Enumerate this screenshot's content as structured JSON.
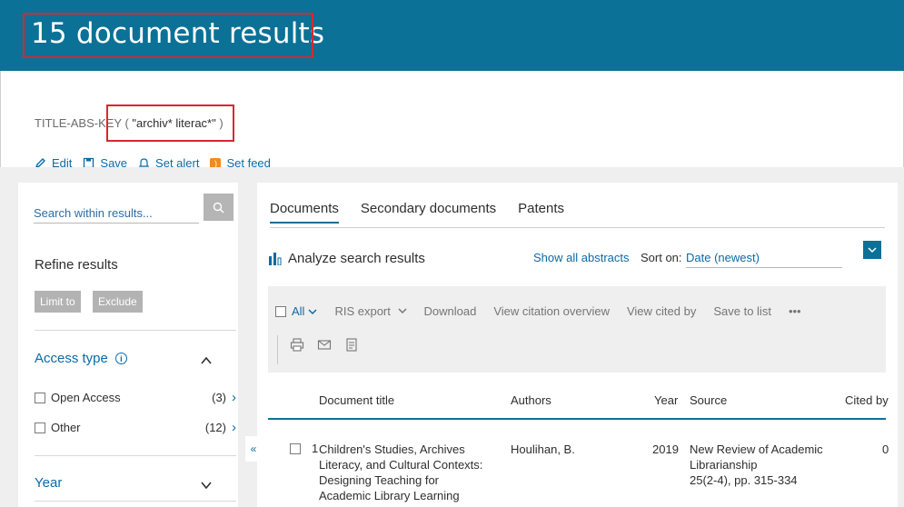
{
  "header": {
    "title": "15 document results"
  },
  "query": {
    "prefix": "TITLE-ABS-KEY",
    "open": " ( ",
    "term": "\"archiv* literac*\"",
    "close": " )"
  },
  "actions": [
    {
      "icon": "pencil-icon",
      "label": "Edit"
    },
    {
      "icon": "save-icon",
      "label": "Save"
    },
    {
      "icon": "bell-icon",
      "label": "Set alert"
    },
    {
      "icon": "rss-icon",
      "label": "Set feed"
    }
  ],
  "sidebar": {
    "search_placeholder": "Search within results...",
    "refine_label": "Refine results",
    "limit_label": "Limit to",
    "exclude_label": "Exclude",
    "facets": {
      "access": {
        "title": "Access type",
        "items": [
          {
            "label": "Open Access",
            "count": "(3)"
          },
          {
            "label": "Other",
            "count": "(12)"
          }
        ]
      },
      "year": {
        "title": "Year"
      }
    }
  },
  "tabs": [
    "Documents",
    "Secondary documents",
    "Patents"
  ],
  "analyze_label": "Analyze search results",
  "show_abstracts": "Show all abstracts",
  "sort": {
    "label": "Sort on:",
    "value": "Date (newest)"
  },
  "toolbar": {
    "all": "All",
    "ris_export": "RIS export",
    "download": "Download",
    "citation_overview": "View citation overview",
    "cited_by": "View cited by",
    "save_to_list": "Save to list",
    "more": "•••"
  },
  "table": {
    "headers": {
      "title": "Document title",
      "authors": "Authors",
      "year": "Year",
      "source": "Source",
      "cited": "Cited by"
    },
    "rows": [
      {
        "num": "1",
        "title": "Children's Studies, Archives Literacy, and Cultural Contexts: Designing Teaching for Academic Library Learning",
        "authors": "Houlihan, B.",
        "year": "2019",
        "source": "New Review of Academic Librarianship",
        "source_detail": "25(2-4), pp. 315-334",
        "cited": "0"
      }
    ]
  },
  "colors": {
    "header_bg": "#0b7196",
    "link": "#0b6aa6",
    "highlight": "#d9272e"
  }
}
